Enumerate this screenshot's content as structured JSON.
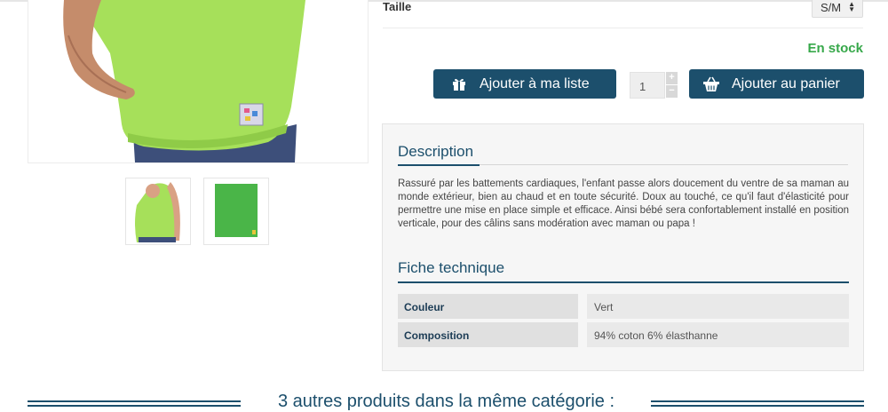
{
  "product": {
    "size_label": "Taille",
    "size_value": "S/M",
    "stock_status": "En stock",
    "quantity": "1",
    "wishlist_button": "Ajouter à ma liste",
    "cart_button": "Ajouter au panier"
  },
  "description": {
    "title": "Description",
    "text": "Rassuré par les battements cardiaques, l'enfant passe alors doucement du ventre de sa maman au monde extérieur, bien au chaud et en toute sécurité. Doux au touché, ce qu'il faut d'élasticité pour permettre une mise en place simple et efficace. Ainsi bébé sera confortablement installé en position verticale, pour des câlins sans modération avec maman ou papa !"
  },
  "specs": {
    "title": "Fiche technique",
    "rows": [
      {
        "name": "Couleur",
        "value": "Vert"
      },
      {
        "name": "Composition",
        "value": "94% coton 6% élasthanne"
      }
    ]
  },
  "related": {
    "heading": "3 autres produits dans la même catégorie :"
  },
  "colors": {
    "accent": "#1c4f6c",
    "stock": "#37a84a",
    "product_green": "#a6e05a"
  },
  "icons": {
    "wishlist": "gift-icon",
    "cart": "basket-icon"
  }
}
